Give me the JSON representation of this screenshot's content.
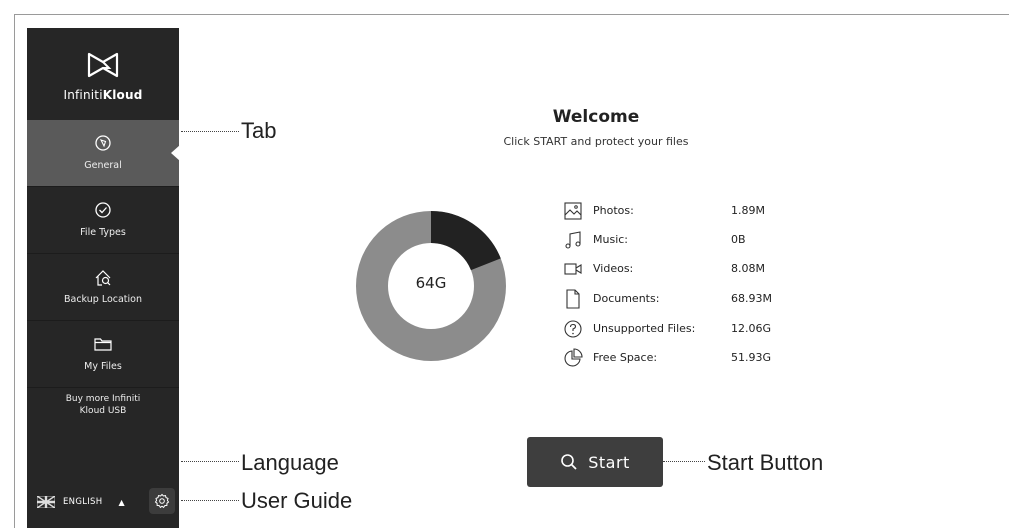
{
  "app": {
    "name_light": "Infiniti",
    "name_bold": "Kloud"
  },
  "sidebar": {
    "items": [
      {
        "label": "General",
        "icon": "compass-icon",
        "active": true
      },
      {
        "label": "File Types",
        "icon": "check-circle-icon",
        "active": false
      },
      {
        "label": "Backup Location",
        "icon": "home-search-icon",
        "active": false
      },
      {
        "label": "My Files",
        "icon": "folder-icon",
        "active": false
      }
    ],
    "buy_more_line1": "Buy more Infiniti",
    "buy_more_line2": "Kloud USB",
    "language": "ENGLISH",
    "language_flag": "uk-flag-icon",
    "user_guide_icon": "gear-icon"
  },
  "main": {
    "title": "Welcome",
    "subtitle": "Click START and protect your files",
    "capacity_label": "64G",
    "used_fraction": 0.19,
    "stats": [
      {
        "label": "Photos:",
        "value": "1.89M",
        "icon": "photo-icon"
      },
      {
        "label": "Music:",
        "value": "0B",
        "icon": "music-icon"
      },
      {
        "label": "Videos:",
        "value": "8.08M",
        "icon": "video-icon"
      },
      {
        "label": "Documents:",
        "value": "68.93M",
        "icon": "document-icon"
      },
      {
        "label": "Unsupported Files:",
        "value": "12.06G",
        "icon": "question-icon"
      },
      {
        "label": "Free Space:",
        "value": "51.93G",
        "icon": "pie-icon"
      }
    ],
    "start_label": "Start"
  },
  "callouts": {
    "tab": "Tab",
    "language": "Language",
    "user_guide": "User Guide",
    "start_button": "Start Button"
  },
  "colors": {
    "sidebar_bg": "#262626",
    "active_tab": "#5a5a5a",
    "donut_used": "#222222",
    "donut_free": "#8c8c8c",
    "start_bg": "#3e3e3e"
  }
}
